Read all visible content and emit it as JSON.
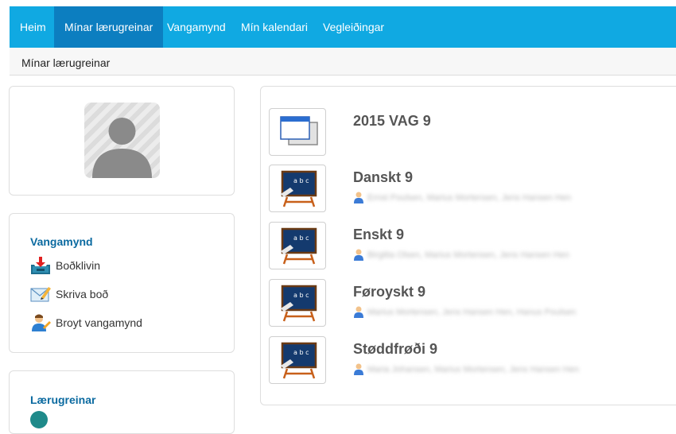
{
  "nav": {
    "items": [
      {
        "label": "Heim",
        "active": false
      },
      {
        "label": "Mínar lærugreinar",
        "active": true
      },
      {
        "label": "Vangamynd",
        "active": false
      },
      {
        "label": "Mín kalendari",
        "active": false
      },
      {
        "label": "Vegleiðingar",
        "active": false
      }
    ]
  },
  "breadcrumb": "Mínar lærugreinar",
  "profile": {
    "section_title": "Vangamynd",
    "links": [
      {
        "label": "Boðklivin",
        "icon": "inbox-download-icon"
      },
      {
        "label": "Skriva boð",
        "icon": "envelope-pencil-icon"
      },
      {
        "label": "Broyt vangamynd",
        "icon": "user-edit-icon"
      }
    ]
  },
  "subjects_sidebar": {
    "section_title": "Lærugreinar"
  },
  "courses": [
    {
      "title": "2015 VAG 9",
      "icon": "window-icon",
      "teachers": ""
    },
    {
      "title": "Danskt 9",
      "icon": "blackboard-icon",
      "teachers": "Ernst Poulsen, Marius Mortensen, Jens Hansen Hen"
    },
    {
      "title": "Enskt 9",
      "icon": "blackboard-icon",
      "teachers": "Birgitta Olsen, Marius Mortensen, Jens Hansen Hen"
    },
    {
      "title": "Føroyskt 9",
      "icon": "blackboard-icon",
      "teachers": "Marius Mortensen, Jens Hansen Hen, Hanus Poulsen"
    },
    {
      "title": "Støddfrøði 9",
      "icon": "blackboard-icon",
      "teachers": "Maria Johansen, Marius Mortensen, Jens Hansen Hen"
    }
  ],
  "colors": {
    "navbar": "#10a9e2",
    "nav_active": "#0c7ec0",
    "sidebar_title": "#0b6aa0"
  }
}
